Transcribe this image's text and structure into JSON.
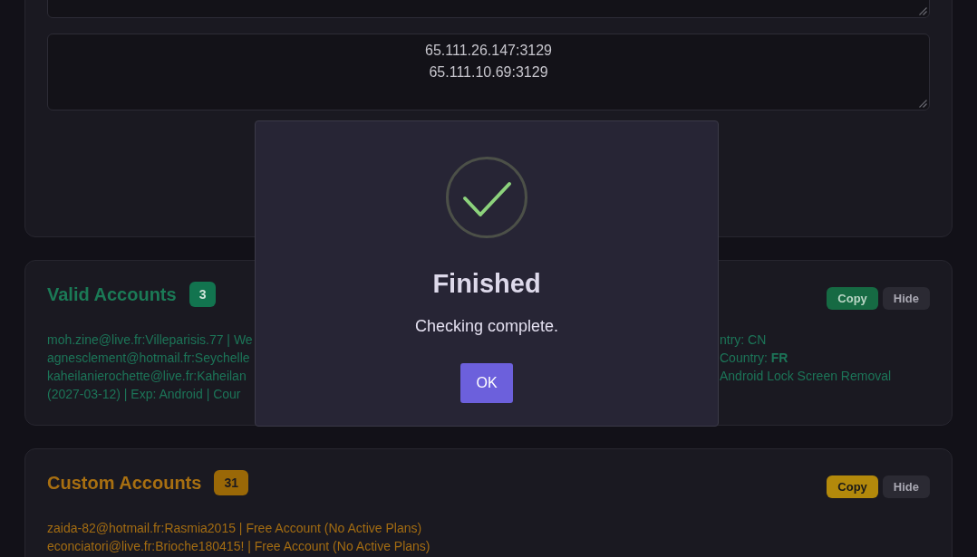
{
  "text_areas": [
    {
      "resizable": true
    },
    {
      "resizable": true,
      "lines": [
        "65.111.26.147:3129",
        "65.111.10.69:3129"
      ]
    }
  ],
  "sections": [
    {
      "kind": "valid",
      "title": "Valid Accounts",
      "count": "3",
      "buttons": [
        {
          "kind": "copy",
          "label": "Copy"
        },
        {
          "kind": "hide",
          "label": "Hide"
        }
      ],
      "lines": [
        {
          "text": "moh.zine@live.fr:Villeparisis.77 | We",
          "text_after_dialog": "ntry: CN"
        },
        {
          "text": "agnesclement@hotmail.fr:Seychelle",
          "text_after_dialog": "Country: **FR**"
        },
        {
          "text": "kaheilanierochette@live.fr:Kaheilan",
          "text_after_dialog": "Android Lock Screen Removal"
        },
        {
          "text": "(2027-03-12) | Exp: Android | Cour"
        }
      ]
    },
    {
      "kind": "custom",
      "title": "Custom Accounts",
      "count": "31",
      "buttons": [
        {
          "kind": "copy",
          "label": "Copy"
        },
        {
          "kind": "hide",
          "label": "Hide"
        }
      ],
      "lines": [
        {
          "text": "zaida-82@hotmail.fr:Rasmia2015 | Free Account (No Active Plans)"
        },
        {
          "text": "econciatori@live.fr:Brioche180415! | Free Account (No Active Plans)"
        }
      ]
    }
  ],
  "dialog": {
    "title": "Finished",
    "message": "Checking complete.",
    "buttons": [
      "OK"
    ]
  }
}
